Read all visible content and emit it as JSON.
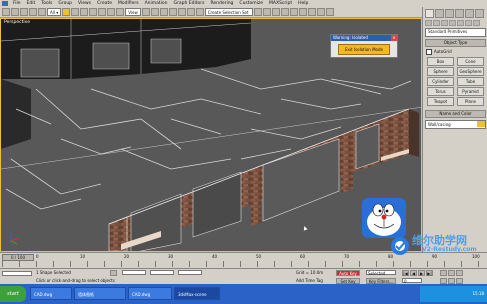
{
  "menu": {
    "items": [
      "File",
      "Edit",
      "Tools",
      "Group",
      "Views",
      "Create",
      "Modifiers",
      "Animation",
      "Graph Editors",
      "Rendering",
      "Customize",
      "MAXScript",
      "Help"
    ]
  },
  "toolbar": {
    "view_select": "View",
    "selection_set": "Create Selection Set"
  },
  "viewport": {
    "label": "Perspective"
  },
  "isolation_dialog": {
    "title": "Warning: Isolated",
    "button_label": "Exit Isolation Mode"
  },
  "command_panel": {
    "category_dropdown": "Standard Primitives",
    "object_type_header": "Object Type",
    "autogrid_label": "AutoGrid",
    "buttons": [
      "Box",
      "Cone",
      "Sphere",
      "GeoSphere",
      "Cylinder",
      "Tube",
      "Torus",
      "Pyramid",
      "Teapot",
      "Plane"
    ],
    "name_color_header": "Name and Color",
    "object_name": "Wall/casing"
  },
  "timeline": {
    "frame_slider": "0 / 100",
    "ticks": [
      "0",
      "10",
      "20",
      "30",
      "40",
      "50",
      "60",
      "70",
      "80",
      "90",
      "100"
    ]
  },
  "status": {
    "selection": "1 Shape Selected",
    "prompt": "Click or click-and-drag to select objects",
    "grid": "Grid = 10.0m",
    "add_time_tag": "Add Time Tag",
    "auto_key": "Auto Key",
    "selected": "Selected",
    "set_key": "Set Key",
    "key_filters": "Key Filters...",
    "frame": "0"
  },
  "taskbar": {
    "start_label": "start",
    "tasks": [
      "CAD.dwg",
      "墙体图纸",
      "CAD.dwg",
      "3dsMax-scene"
    ],
    "time": "15:18"
  },
  "watermark": {
    "text": "维尔助学网",
    "url": "V2-Restudy.com"
  },
  "colors": {
    "viewport_bg": "#585858",
    "active_border": "#f0c030",
    "isolation_button": "#f5b820",
    "taskbar": "#2a62c8"
  }
}
